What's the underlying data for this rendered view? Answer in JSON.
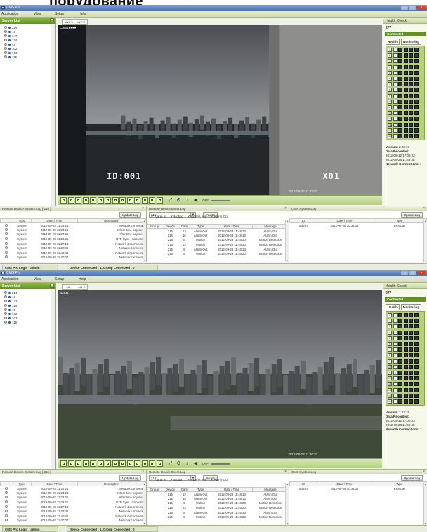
{
  "page_heading": "порудование",
  "app": {
    "title": "CMS Pro",
    "menu": [
      "Application",
      "View",
      "Setup",
      "Help"
    ]
  },
  "sidebar": {
    "header": "Server List",
    "pin": "×",
    "servers": [
      "214",
      "46",
      "147",
      "114",
      "45",
      "102",
      "103",
      "115"
    ],
    "tabs": [
      "Server List",
      "Map List"
    ]
  },
  "cam_tabs": [
    "Live 1",
    "Live 2"
  ],
  "screens": [
    {
      "camera_label": "CAM1●●●●",
      "osd_left": "ID:001",
      "osd_right": "X01",
      "timestamp": "2012-09-28 11:47:02"
    },
    {
      "camera_label": "CAM1",
      "osd_left": "",
      "osd_right": "",
      "timestamp": "2012-09-28 11:46:20"
    }
  ],
  "controls": {
    "off_label": "OFF"
  },
  "health": {
    "title": "Health Check",
    "system": "277",
    "status": "Connected",
    "tabs": [
      "Health",
      "Monitoring"
    ],
    "rows": [
      "1",
      "2",
      "3",
      "4",
      "5",
      "6",
      "7",
      "8",
      "9",
      "10",
      "11",
      "12",
      "13",
      "14",
      "15",
      "16"
    ],
    "version_label": "Version:",
    "version": "2.23.19",
    "data_label": "Data Recorded:",
    "data_from": "2012-09-12 17:06:23",
    "data_to": "2012-09-28 11:46:45",
    "network_label": "Network Connections:",
    "network_value": "1"
  },
  "log1": {
    "title": "Remote Device System Log [ 215 ]",
    "update": "Update Log",
    "columns": [
      "Type",
      "Date / Time",
      "Description"
    ],
    "rows": [
      [
        "System",
        "2012-09-28 11:24:21",
        "Network connected"
      ],
      [
        "System",
        "2012-09-28 11:24:21",
        "Before time adjusted."
      ],
      [
        "System",
        "2012-09-28 11:24:21",
        "After time adjusted."
      ],
      [
        "System",
        "2012-09-28 11:24:21",
        "NTP Sync : Success !"
      ],
      [
        "System",
        "2012-09-28 11:27:14",
        "Network disconnected"
      ],
      [
        "System",
        "2012-09-28 11:28:35",
        "Network connected"
      ],
      [
        "System",
        "2012-09-28 11:40:48",
        "Network disconnected"
      ],
      [
        "System",
        "2012-09-28 11:40:07",
        "Network connected"
      ]
    ]
  },
  "log2": {
    "title": "Remote Device Event Log",
    "device": "215",
    "pause": "Pause",
    "filters": [
      "Alarm In",
      "Motion",
      "Video Loss",
      "Alarm Out"
    ],
    "columns": [
      "Group",
      "Device",
      "Cam",
      "Type",
      "Date / Time",
      "Message"
    ],
    "rows": [
      [
        "",
        "215",
        "13",
        "Alarm Out",
        "2012-09-28 11:48:13",
        "Alarm Out"
      ],
      [
        "",
        "215",
        "16",
        "Alarm Out",
        "2012-09-28 11:48:13",
        "Alarm Out"
      ],
      [
        "",
        "215",
        "5",
        "Motion",
        "2012-09-28 11:48:20",
        "Motion Detection"
      ],
      [
        "",
        "215",
        "24",
        "Motion",
        "2012-09-28 11:48:20",
        "Motion Detection"
      ],
      [
        "",
        "215",
        "5",
        "Alarm Out",
        "2012-09-28 11:48:13",
        "Alarm Out"
      ],
      [
        "",
        "215",
        "5",
        "Motion",
        "2012-09-28 11:48:20",
        "Motion Detection"
      ]
    ]
  },
  "log3": {
    "title": "CMS System Log",
    "update": "Update Log",
    "columns": [
      "ID",
      "Date / Time",
      "Type"
    ],
    "rows": [
      [
        "admin",
        "2012-09-28 10:38:32",
        "Execute"
      ]
    ]
  },
  "status": {
    "login": "CMS Pro Login : admin",
    "connections": "Device Connected : 1, Group Connected : 0"
  }
}
